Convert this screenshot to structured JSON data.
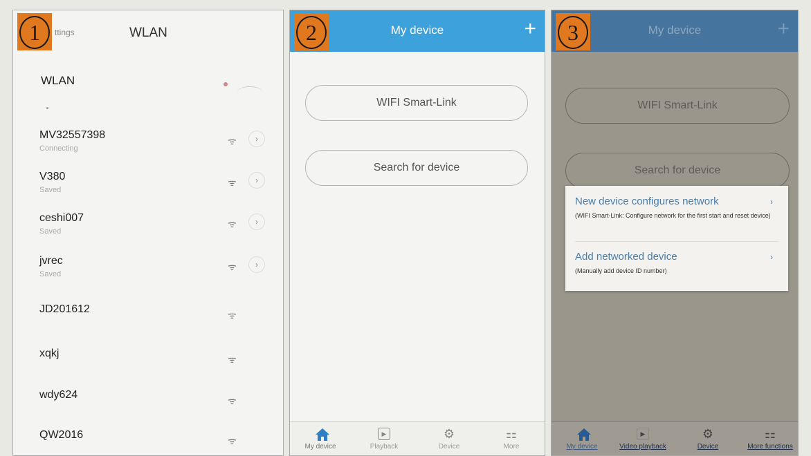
{
  "badges": [
    "1",
    "2",
    "3"
  ],
  "panel1": {
    "back_label": "ttings",
    "title": "WLAN",
    "wlan_label": "WLAN",
    "networks": [
      {
        "name": "MV32557398",
        "status": "Connecting"
      },
      {
        "name": "V380",
        "status": "Saved"
      },
      {
        "name": "ceshi007",
        "status": "Saved"
      },
      {
        "name": "jvrec",
        "status": "Saved"
      },
      {
        "name": "JD201612",
        "status": ""
      },
      {
        "name": "xqkj",
        "status": ""
      },
      {
        "name": "wdy624",
        "status": ""
      },
      {
        "name": "QW2016",
        "status": ""
      }
    ]
  },
  "panel2": {
    "title": "My device",
    "plus": "+",
    "smartlink_label": "WIFI Smart-Link",
    "search_label": "Search for device",
    "tabs": [
      "My device",
      "Playback",
      "Device",
      "More"
    ]
  },
  "panel3": {
    "title": "My device",
    "plus": "+",
    "smartlink_label": "WIFI Smart-Link",
    "search_label": "Search for device",
    "popup": {
      "item1_title": "New device configures network",
      "item1_sub": "(WIFI Smart-Link: Configure network for the first start and reset device)",
      "item2_title": "Add networked device",
      "item2_sub": "(Manually add device ID number)"
    },
    "tabs": [
      "My device",
      "Video playback",
      "Device",
      "More functions"
    ]
  },
  "colors": {
    "header_blue": "#3da1dc",
    "badge_orange": "#e07820"
  },
  "icons": [
    "home-icon",
    "play-icon",
    "gear-icon",
    "more-grid-icon",
    "wifi-lock-icon",
    "chevron-right-icon"
  ]
}
